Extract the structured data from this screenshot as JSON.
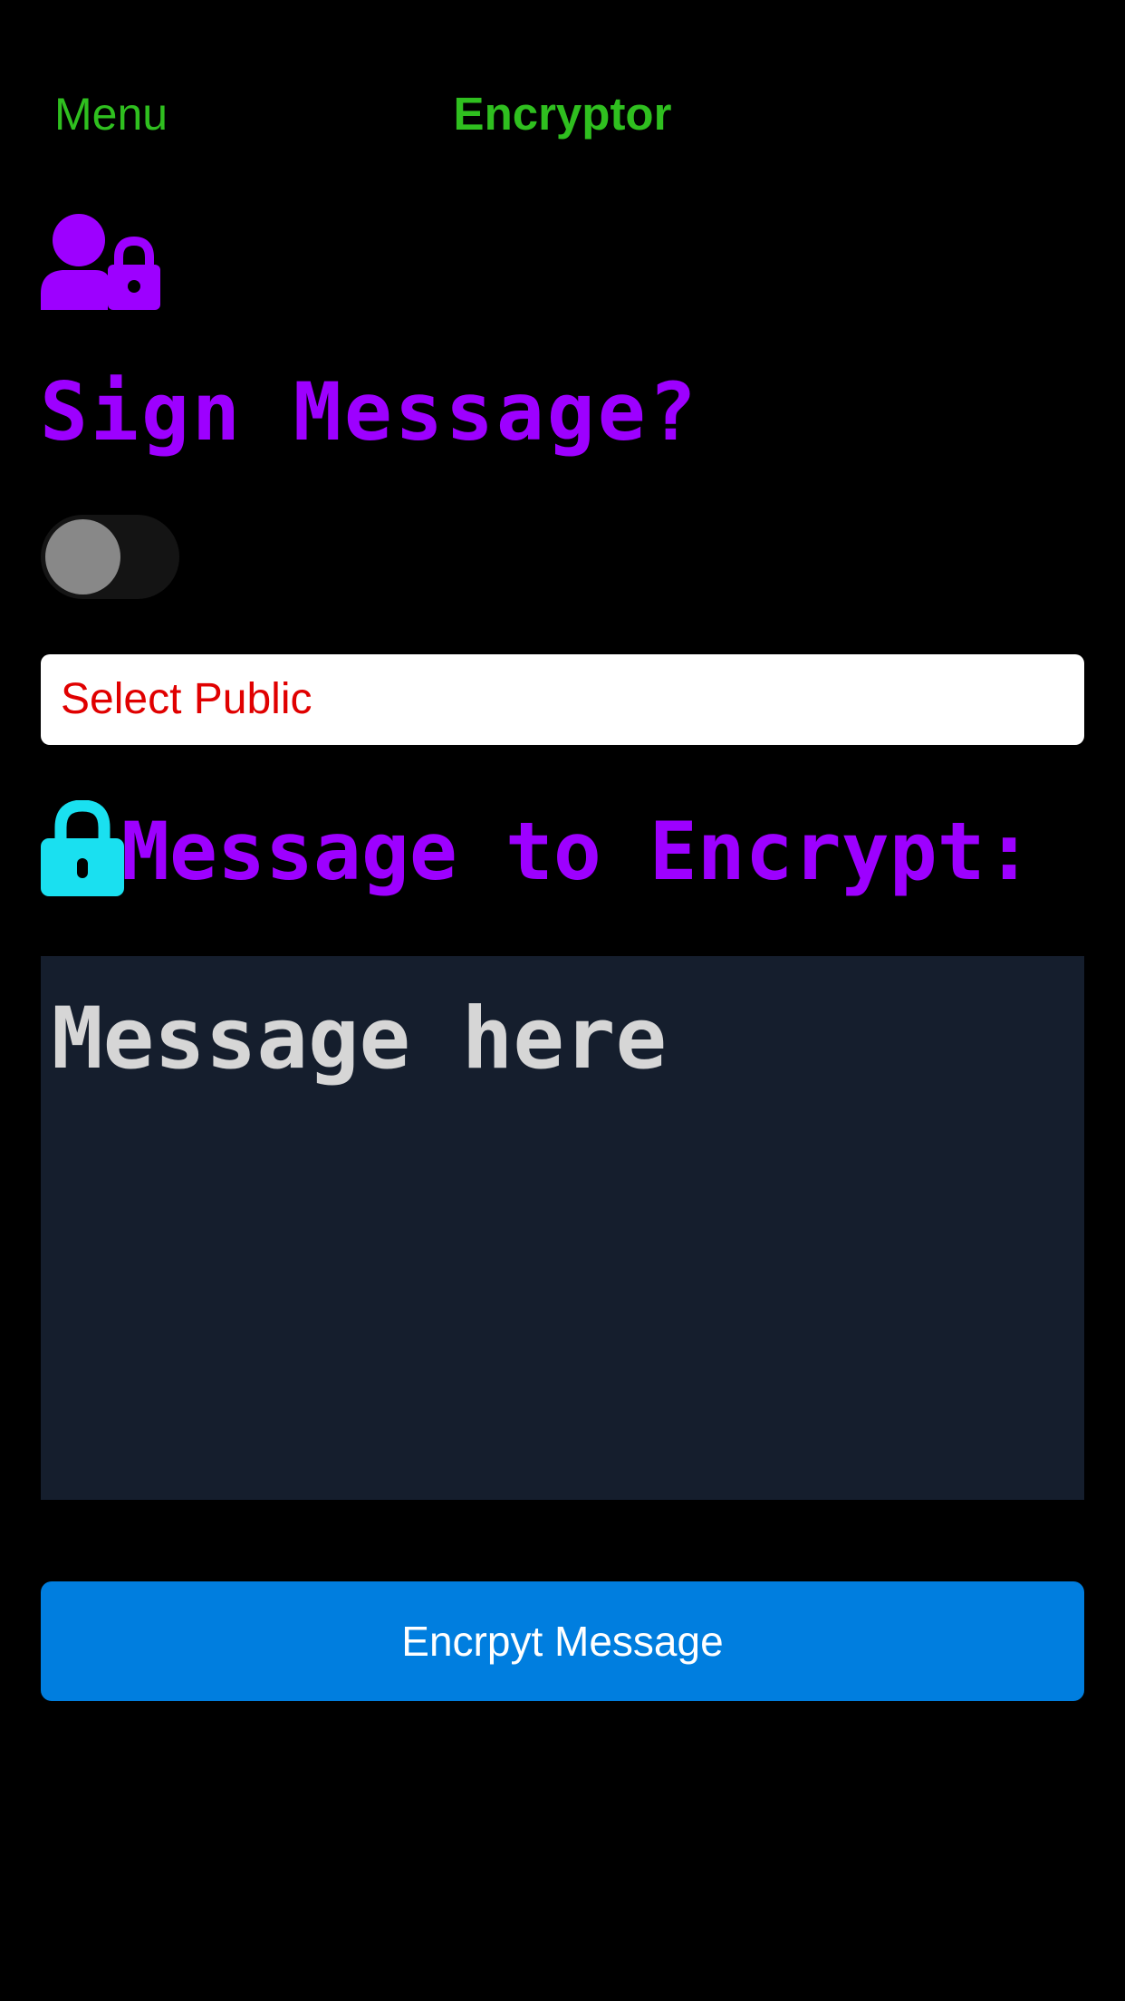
{
  "nav": {
    "menu_label": "Menu",
    "title": "Encryptor"
  },
  "sign": {
    "icon": "user-lock-icon",
    "heading": "Sign Message?",
    "toggle_on": false
  },
  "public_key_select": {
    "label": "Select Public"
  },
  "message": {
    "icon": "lock-icon",
    "heading": "Message to Encrypt:",
    "placeholder": "Message here",
    "value": ""
  },
  "encrypt_button": {
    "label": "Encrpyt Message"
  },
  "colors": {
    "background": "#000000",
    "nav_green": "#2fbf1f",
    "heading_purple": "#9d00ff",
    "lock_cyan": "#1ae0f0",
    "select_text_red": "#e00000",
    "textarea_bg": "#151e2d",
    "button_blue": "#007edf"
  }
}
